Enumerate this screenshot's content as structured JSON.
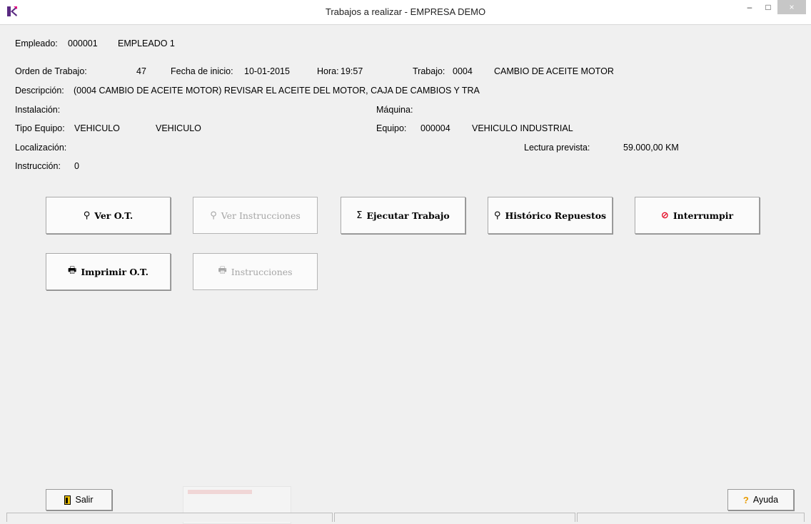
{
  "window": {
    "title": "Trabajos a realizar - EMPRESA DEMO",
    "min_symbol": "–",
    "max_symbol": "□",
    "close_symbol": "×"
  },
  "info": {
    "empleado_label": "Empleado:",
    "empleado_code": "000001",
    "empleado_name": "EMPLEADO 1",
    "orden_label": "Orden de Trabajo:",
    "orden_value": "47",
    "fecha_label": "Fecha de inicio:",
    "fecha_value": "10-01-2015",
    "hora_label": "Hora:",
    "hora_value": "19:57",
    "trabajo_label": "Trabajo:",
    "trabajo_code": "0004",
    "trabajo_name": "CAMBIO DE ACEITE MOTOR",
    "descripcion_label": "Descripción:",
    "descripcion_value": "(0004 CAMBIO DE ACEITE MOTOR) REVISAR EL ACEITE DEL MOTOR, CAJA DE CAMBIOS Y TRA",
    "instalacion_label": "Instalación:",
    "maquina_label": "Máquina:",
    "tipo_equipo_label": "Tipo Equipo:",
    "tipo_equipo_code": "VEHICULO",
    "tipo_equipo_name": "VEHICULO",
    "equipo_label": "Equipo:",
    "equipo_code": "000004",
    "equipo_name": "VEHICULO INDUSTRIAL",
    "localizacion_label": "Localización:",
    "lectura_label": "Lectura prevista:",
    "lectura_value": "59.000,00 KM",
    "instruccion_label": "Instrucción:",
    "instruccion_value": "0"
  },
  "buttons": {
    "ver_ot": "Ver O.T.",
    "ver_instrucciones": "Ver Instrucciones",
    "ejecutar_trabajo": "Ejecutar Trabajo",
    "historico_repuestos": "Histórico Repuestos",
    "interrumpir": "Interrumpir",
    "imprimir_ot": "Imprimir O.T.",
    "instrucciones": "Instrucciones",
    "salir": "Salir",
    "ayuda": "Ayuda"
  },
  "icons": {
    "search": "⚲",
    "sigma": "Σ",
    "no": "⊘",
    "printer": "🖶",
    "help": "?"
  },
  "colors": {
    "accent_red": "#e3001b",
    "help_orange": "#e89b00",
    "exit_yellow": "#f0c400"
  }
}
